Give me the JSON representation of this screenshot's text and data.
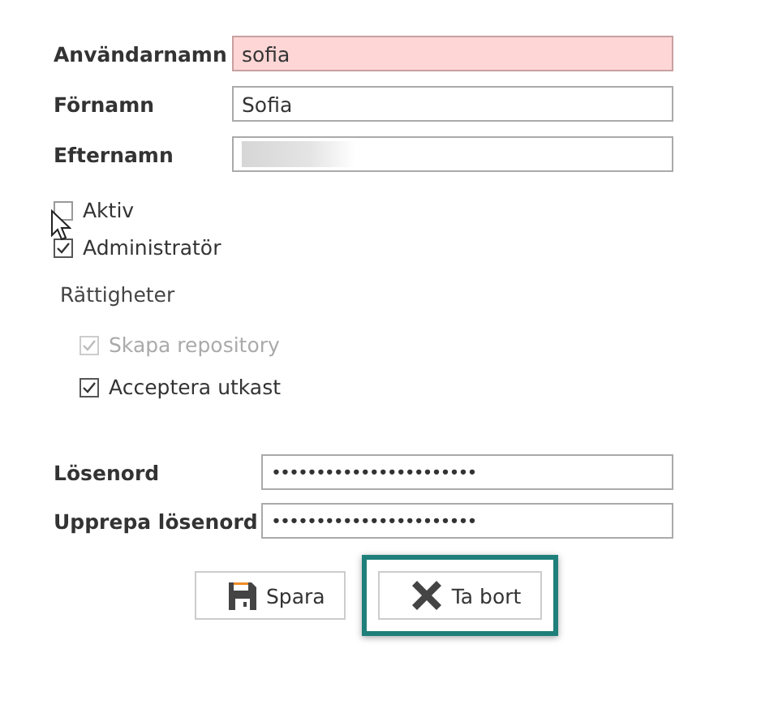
{
  "fields": [
    {
      "label": "Användarnamn",
      "value": "sofia",
      "invalid": true,
      "blurred": false
    },
    {
      "label": "Förnamn",
      "value": "Sofia",
      "invalid": false,
      "blurred": false
    },
    {
      "label": "Efternamn",
      "invalid": false,
      "blurred": true
    }
  ],
  "flags": [
    {
      "label": "Aktiv",
      "checked": false,
      "disabled": false
    },
    {
      "label": "Administratör",
      "checked": true,
      "disabled": false
    }
  ],
  "permissions": {
    "title": "Rättigheter",
    "items": [
      {
        "label": "Skapa repository",
        "checked": true,
        "disabled": true
      },
      {
        "label": "Acceptera utkast",
        "checked": true,
        "disabled": false
      }
    ]
  },
  "passwords": [
    {
      "label": "Lösenord",
      "value": "•••••••••••••••••••••••"
    },
    {
      "label": "Upprepa lösenord",
      "value": "•••••••••••••••••••••••"
    }
  ],
  "buttons": [
    {
      "label": "Spara",
      "kind": "save",
      "highlighted": false
    },
    {
      "label": "Ta bort",
      "kind": "delete",
      "highlighted": true
    }
  ]
}
